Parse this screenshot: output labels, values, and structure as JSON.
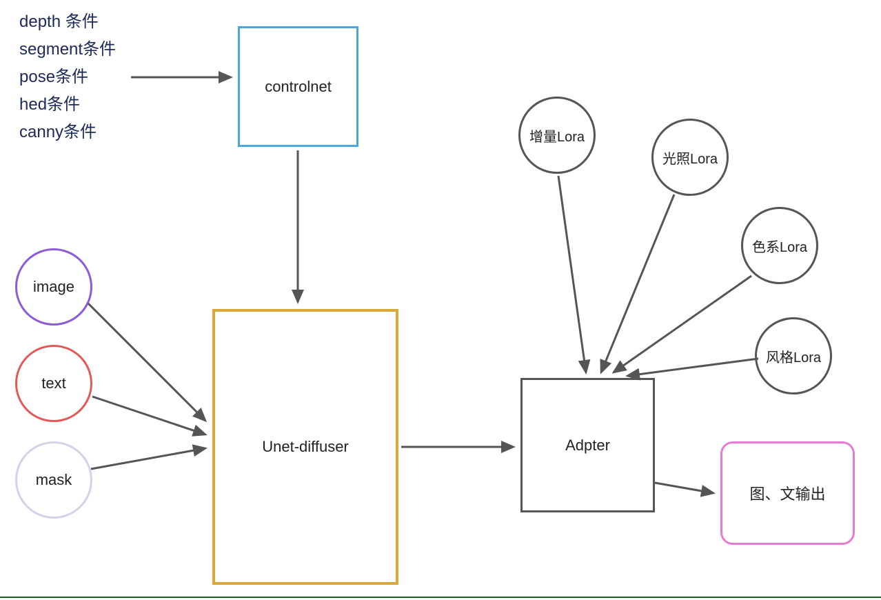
{
  "conditions": {
    "items": [
      "depth 条件",
      "segment条件",
      "pose条件",
      "hed条件",
      "canny条件"
    ]
  },
  "controlnet": {
    "label": "controlnet"
  },
  "inputs": {
    "image": "image",
    "text": "text",
    "mask": "mask"
  },
  "unet": {
    "label": "Unet-diffuser"
  },
  "adapter": {
    "label": "Adpter"
  },
  "loras": {
    "a": "增量Lora",
    "b": "光照Lora",
    "c": "色系Lora",
    "d": "风格Lora"
  },
  "output": {
    "label": "图、文输出"
  },
  "colors": {
    "controlnet_border": "#4aa7d8",
    "unet_border": "#d9a93c",
    "adapter_border": "#555555",
    "output_border": "#e77ad1",
    "image_border": "#8a5cd6",
    "text_border": "#e05a5a",
    "mask_border": "#d9d0e8",
    "lora_border": "#555555",
    "arrow": "#555555",
    "condition_text": "#1b2a57"
  }
}
